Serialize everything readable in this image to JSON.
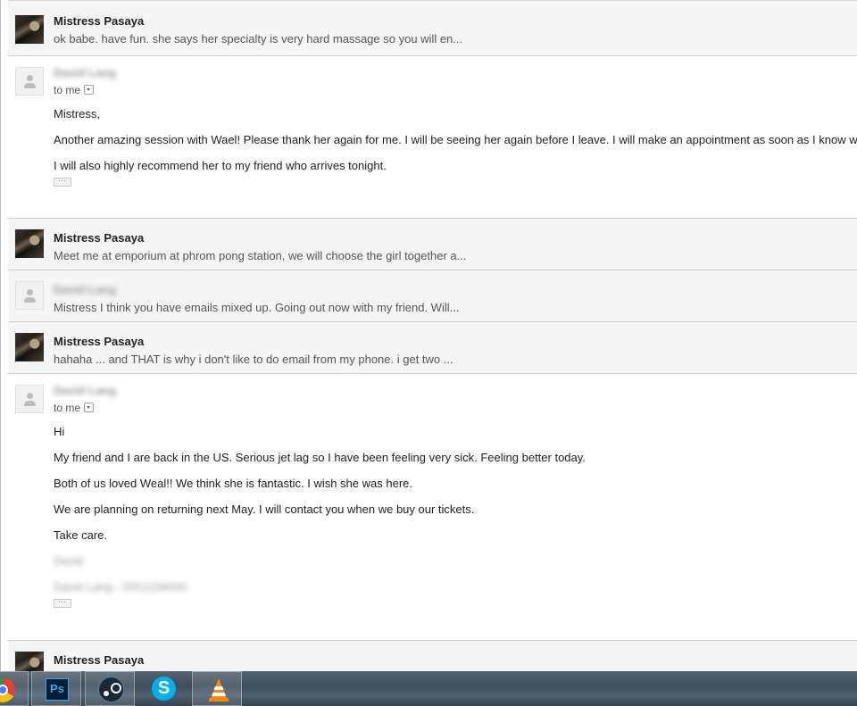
{
  "messages": [
    {
      "sender": "Mistress Pasaya",
      "snippet": "ok babe. have fun. she says her specialty is very hard massage so you will en..."
    },
    {
      "sender": "David Lang",
      "to": "to me",
      "body": [
        "Mistress,",
        "Another amazing session with Wael! Please thank her again for me. I will be seeing her again before I leave. I will make an appointment as soon as I know when.",
        "I will also highly recommend her to my friend who arrives tonight."
      ]
    },
    {
      "sender": "Mistress Pasaya",
      "snippet": "Meet me at emporium at phrom pong station, we will choose the girl together a..."
    },
    {
      "sender": "David Lang",
      "snippet": "Mistress I think you have emails mixed up. Going out now with my friend. Will..."
    },
    {
      "sender": "Mistress Pasaya",
      "snippet": "hahaha ... and THAT is why i don't like to do email from my phone. i get two ..."
    },
    {
      "sender": "David Lang",
      "to": "to me",
      "body": [
        "Hi",
        "My friend and I are back in the US. Serious jet lag so I have been feeling very sick. Feeling better today.",
        "Both of us loved Weal!! We think she is fantastic. I wish she was here.",
        "We are planning on returning next May. I will contact you when we buy our tickets.",
        "Take care."
      ],
      "signature": [
        "David",
        "David Lang - 5551234000"
      ]
    },
    {
      "sender": "Mistress Pasaya",
      "snippet": ""
    }
  ],
  "ellipsis_label": "...",
  "taskbar": {
    "apps": [
      {
        "icon": "chrome-icon"
      },
      {
        "icon": "photoshop-icon",
        "label": "Ps"
      },
      {
        "icon": "steam-icon"
      },
      {
        "icon": "skype-icon",
        "label": "S"
      },
      {
        "icon": "vlc-icon"
      }
    ]
  },
  "colors": {
    "collapsed_bg": "#f5f5f5",
    "divider": "#cfcfcf",
    "text": "#222222",
    "snippet_text": "#555555",
    "taskbar": "#3e4e5a"
  }
}
